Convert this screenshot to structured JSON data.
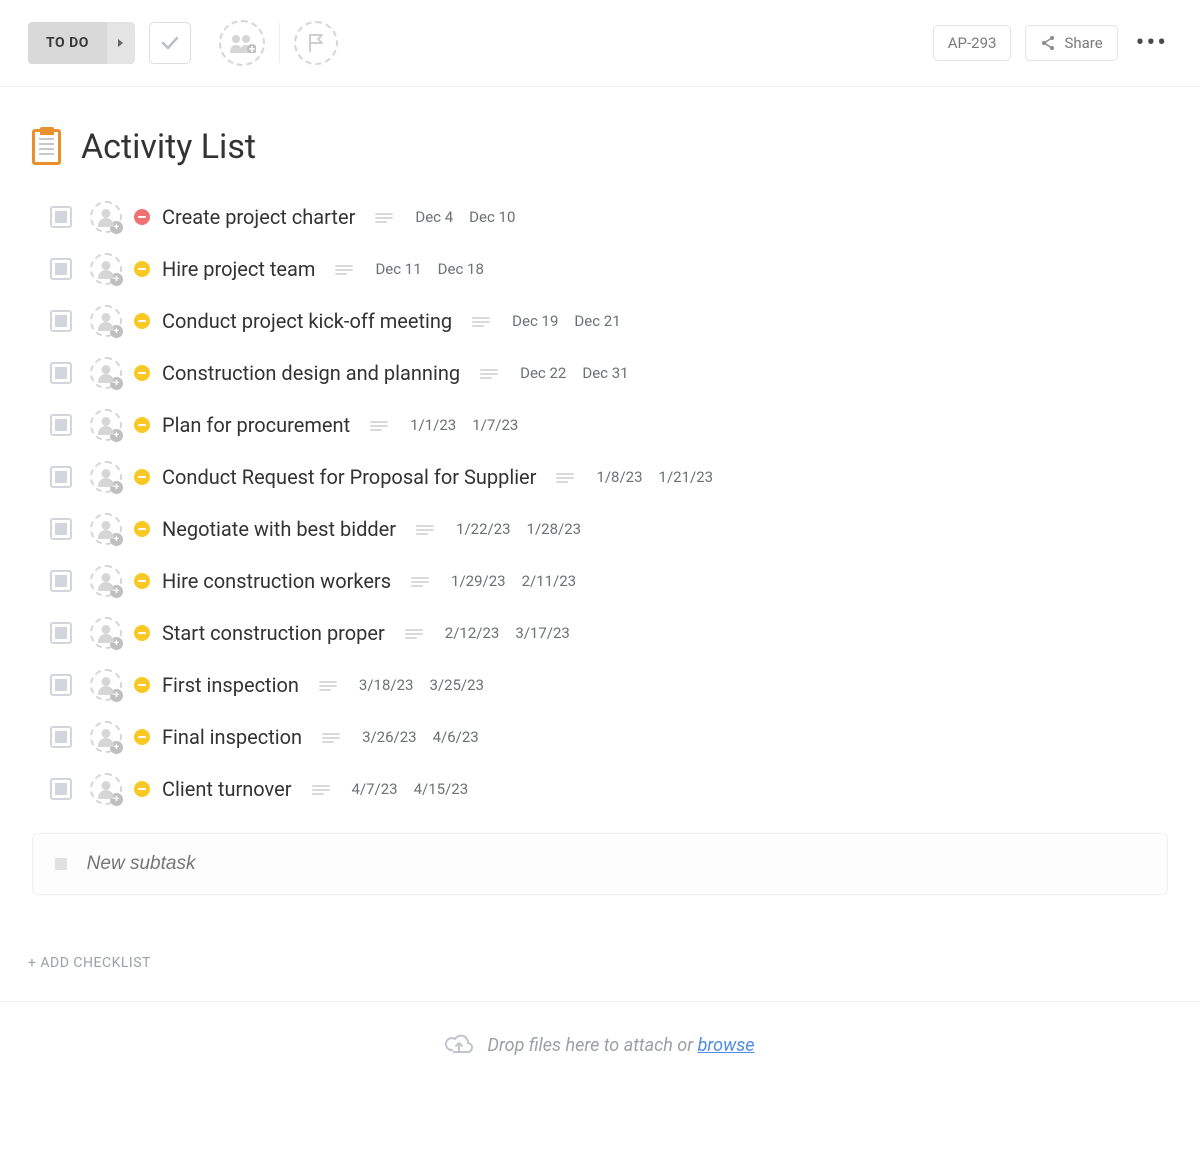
{
  "toolbar": {
    "status_label": "TO DO",
    "task_id": "AP-293",
    "share_label": "Share"
  },
  "page": {
    "title": "Activity List"
  },
  "tasks": [
    {
      "title": "Create project charter",
      "priority": "red",
      "start": "Dec 4",
      "end": "Dec 10"
    },
    {
      "title": "Hire project team",
      "priority": "yellow",
      "start": "Dec 11",
      "end": "Dec 18"
    },
    {
      "title": "Conduct project kick-off meeting",
      "priority": "yellow",
      "start": "Dec 19",
      "end": "Dec 21"
    },
    {
      "title": "Construction design and planning",
      "priority": "yellow",
      "start": "Dec 22",
      "end": "Dec 31"
    },
    {
      "title": "Plan for procurement",
      "priority": "yellow",
      "start": "1/1/23",
      "end": "1/7/23"
    },
    {
      "title": "Conduct Request for Proposal for Supplier",
      "priority": "yellow",
      "start": "1/8/23",
      "end": "1/21/23"
    },
    {
      "title": "Negotiate with best bidder",
      "priority": "yellow",
      "start": "1/22/23",
      "end": "1/28/23"
    },
    {
      "title": "Hire construction workers",
      "priority": "yellow",
      "start": "1/29/23",
      "end": "2/11/23"
    },
    {
      "title": "Start construction proper",
      "priority": "yellow",
      "start": "2/12/23",
      "end": "3/17/23"
    },
    {
      "title": "First inspection",
      "priority": "yellow",
      "start": "3/18/23",
      "end": "3/25/23"
    },
    {
      "title": "Final inspection",
      "priority": "yellow",
      "start": "3/26/23",
      "end": "4/6/23"
    },
    {
      "title": "Client turnover",
      "priority": "yellow",
      "start": "4/7/23",
      "end": "4/15/23"
    }
  ],
  "new_subtask": {
    "placeholder": "New subtask"
  },
  "add_checklist_label": "+ ADD CHECKLIST",
  "dropzone": {
    "text": "Drop files here to attach or ",
    "link": "browse"
  }
}
